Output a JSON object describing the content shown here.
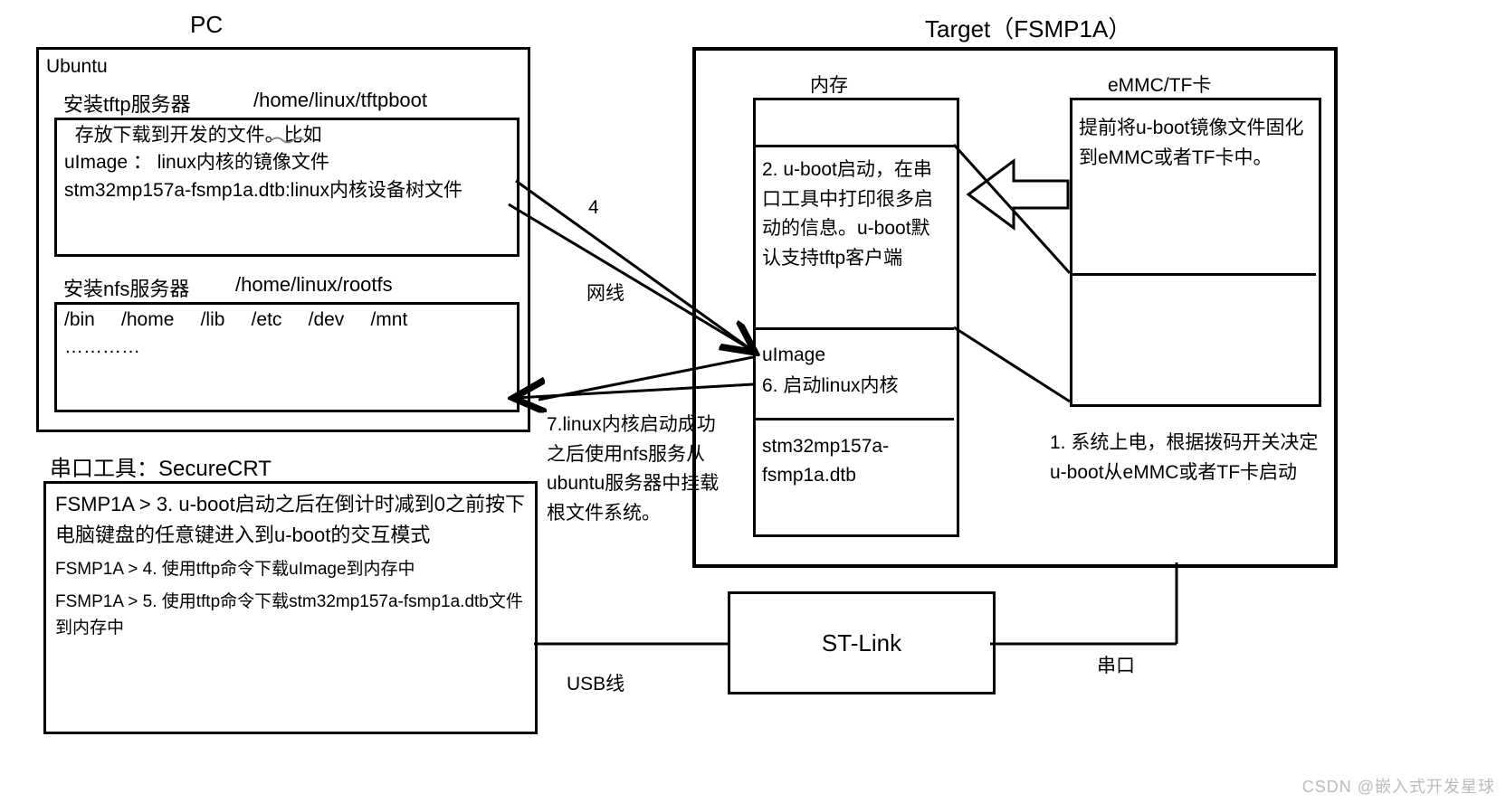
{
  "titles": {
    "pc": "PC",
    "target": "Target（FSMP1A）",
    "ubuntu": "Ubuntu",
    "mem": "内存",
    "emmc": "eMMC/TF卡",
    "stlink": "ST-Link",
    "wire_net": "网线",
    "wire_usb": "USB线",
    "wire_serial": "串口",
    "step4": "4"
  },
  "tftp": {
    "header_left": "安装tftp服务器",
    "header_right": "/home/linux/tftpboot",
    "body": "  存放下载到开发的文件。比如\nuImage ： linux内核的镜像文件\nstm32mp157a-fsmp1a.dtb:linux内核设备树文件"
  },
  "nfs": {
    "header_left": "安装nfs服务器",
    "header_right": "/home/linux/rootfs",
    "body": "/bin     /home     /lib     /etc     /dev     /mnt\n…………"
  },
  "crt": {
    "title": "串口工具：SecureCRT",
    "line1": "FSMP1A > 3. u-boot启动之后在倒计时减到0之前按下电脑键盘的任意键进入到u-boot的交互模式",
    "line2": "FSMP1A > 4. 使用tftp命令下载uImage到内存中",
    "line3": "FSMP1A > 5. 使用tftp命令下载stm32mp157a-fsmp1a.dtb文件到内存中"
  },
  "mem": {
    "row2": "2. u-boot启动，在串口工具中打印很多启动的信息。u-boot默认支持tftp客户端",
    "row3": "uImage\n6. 启动linux内核",
    "row4": "stm32mp157a-fsmp1a.dtb"
  },
  "emmc": {
    "row1": "提前将u-boot镜像文件固化到eMMC或者TF卡中。"
  },
  "step1": "1. 系统上电，根据拨码开关决定u-boot从eMMC或者TF卡启动",
  "step7": "7.linux内核启动成功之后使用nfs服务从ubuntu服务器中挂载根文件系统。",
  "watermark": "CSDN @嵌入式开发星球"
}
